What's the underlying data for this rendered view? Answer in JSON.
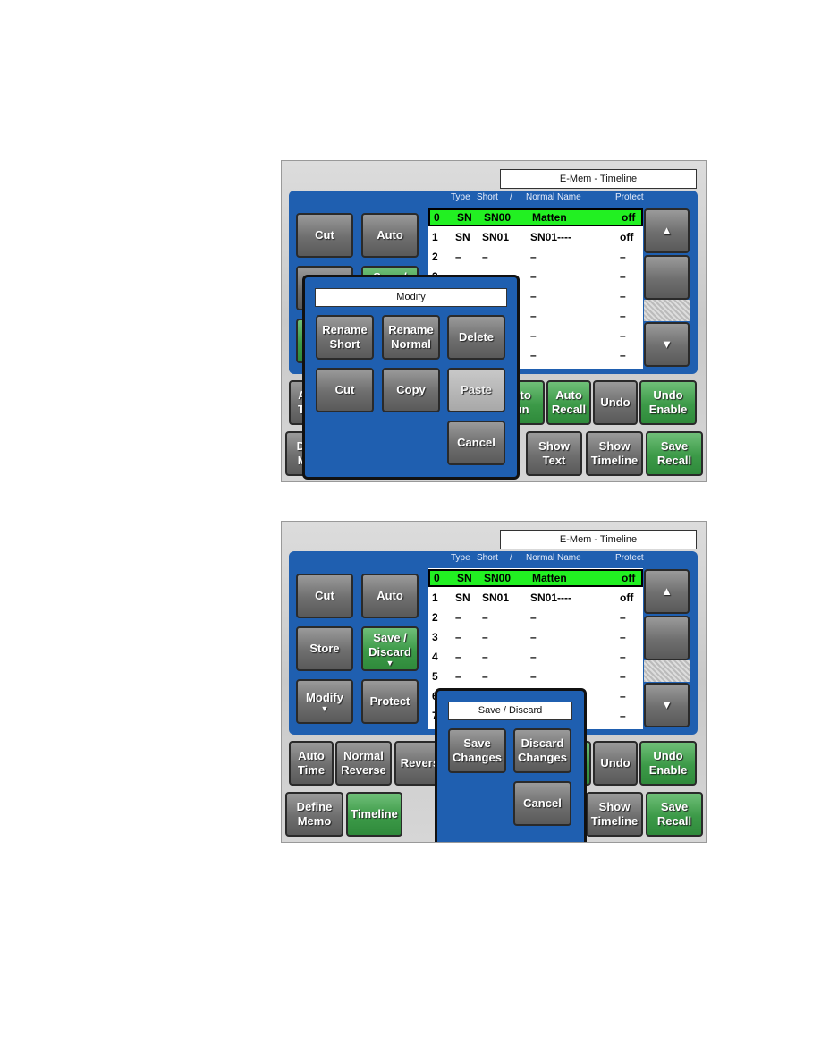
{
  "panel_title": "E-Mem - Timeline",
  "columns": {
    "type": "Type",
    "short": "Short",
    "slash": "/",
    "normal": "Normal Name",
    "protect": "Protect"
  },
  "rows": [
    {
      "num": "0",
      "type": "SN",
      "short": "SN00",
      "normal": "Matten",
      "protect": "off"
    },
    {
      "num": "1",
      "type": "SN",
      "short": "SN01",
      "normal": "SN01----",
      "protect": "off"
    },
    {
      "num": "2",
      "type": "–",
      "short": "–",
      "normal": "–",
      "protect": "–"
    },
    {
      "num": "3",
      "type": "–",
      "short": "–",
      "normal": "–",
      "protect": "–"
    },
    {
      "num": "4",
      "type": "–",
      "short": "–",
      "normal": "–",
      "protect": "–"
    },
    {
      "num": "5",
      "type": "–",
      "short": "–",
      "normal": "–",
      "protect": "–"
    },
    {
      "num": "6",
      "type": "–",
      "short": "–",
      "normal": "–",
      "protect": "–"
    },
    {
      "num": "7",
      "type": "–",
      "short": "–",
      "normal": "–",
      "protect": "–"
    }
  ],
  "scroll": {
    "up": "▲",
    "down": "▼"
  },
  "buttons": {
    "cut": "Cut",
    "auto": "Auto",
    "store": "Store",
    "save_discard": "Save /\nDiscard",
    "modify": "Modify",
    "protect": "Protect",
    "auto_time": "Auto\nTime",
    "normal_reverse": "Normal\nReverse",
    "reverse": "Reverse",
    "auto_run": "Auto\nRun",
    "auto_recall": "Auto\nRecall",
    "undo": "Undo",
    "undo_enable": "Undo\nEnable",
    "define_memo": "Define\nMemo",
    "timeline": "Timeline",
    "show_text": "Show\nText",
    "show_timeline": "Show\nTimeline",
    "save_recall": "Save\nRecall"
  },
  "modify_popup": {
    "title": "Modify",
    "rename_short": "Rename\nShort",
    "rename_normal": "Rename\nNormal",
    "delete": "Delete",
    "cut": "Cut",
    "copy": "Copy",
    "paste": "Paste",
    "cancel": "Cancel"
  },
  "save_discard_popup": {
    "title": "Save / Discard",
    "save_changes": "Save\nChanges",
    "discard_changes": "Discard\nChanges",
    "cancel": "Cancel"
  },
  "colors": {
    "panel_blue": "#1f5fb0",
    "selected_row": "#22f022",
    "green_button": "#3c9a48"
  }
}
